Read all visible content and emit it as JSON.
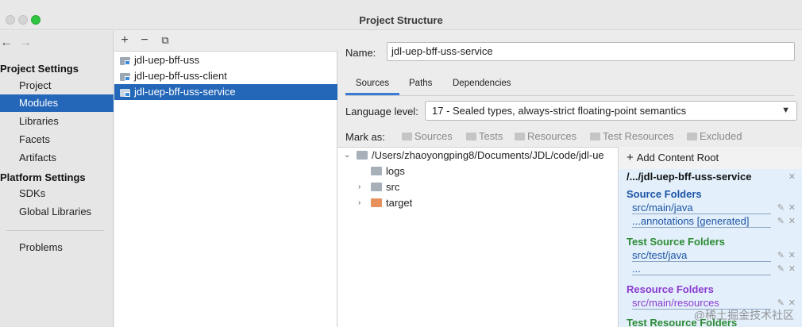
{
  "window": {
    "title": "Project Structure"
  },
  "sidebar": {
    "back_glyph": "←",
    "forward_glyph": "→",
    "project_settings_header": "Project Settings",
    "project_items": [
      {
        "label": "Project"
      },
      {
        "label": "Modules",
        "selected": true
      },
      {
        "label": "Libraries"
      },
      {
        "label": "Facets"
      },
      {
        "label": "Artifacts"
      }
    ],
    "platform_settings_header": "Platform Settings",
    "platform_items": [
      {
        "label": "SDKs"
      },
      {
        "label": "Global Libraries"
      }
    ],
    "problems": {
      "label": "Problems"
    }
  },
  "module_toolbar": {
    "add_glyph": "+",
    "remove_glyph": "−",
    "copy_glyph": "⧉"
  },
  "modules": [
    {
      "label": "jdl-uep-bff-uss"
    },
    {
      "label": "jdl-uep-bff-uss-client"
    },
    {
      "label": "jdl-uep-bff-uss-service",
      "selected": true
    }
  ],
  "details": {
    "name_label": "Name:",
    "name_value": "jdl-uep-bff-uss-service",
    "tabs": [
      {
        "label": "Sources",
        "active": true
      },
      {
        "label": "Paths"
      },
      {
        "label": "Dependencies"
      }
    ],
    "language_level_label": "Language level:",
    "language_level_value": "17 - Sealed types, always-strict floating-point semantics",
    "mark_as_label": "Mark as:",
    "mark_buttons": [
      {
        "label": "Sources"
      },
      {
        "label": "Tests"
      },
      {
        "label": "Resources"
      },
      {
        "label": "Test Resources"
      },
      {
        "label": "Excluded"
      }
    ]
  },
  "tree": {
    "root": "/Users/zhaoyongping8/Documents/JDL/code/jdl-ue",
    "children": [
      {
        "label": "logs",
        "expandable": false
      },
      {
        "label": "src",
        "expandable": true
      },
      {
        "label": "target",
        "expandable": true,
        "color": "#e7915c"
      }
    ]
  },
  "content_root": {
    "add_label": "Add Content Root",
    "path": "/.../jdl-uep-bff-uss-service",
    "source_folders_title": "Source Folders",
    "source_folders": [
      "src/main/java",
      "...annotations [generated]"
    ],
    "test_source_folders_title": "Test Source Folders",
    "test_source_folders": [
      "src/test/java",
      "..."
    ],
    "resource_folders_title": "Resource Folders",
    "resource_folders": [
      "src/main/resources"
    ],
    "test_resource_folders_title": "Test Resource Folders"
  },
  "watermark": "@稀土掘金技术社区",
  "colors": {
    "selection": "#2466b8",
    "source_blue": "#1c55a6",
    "test_green": "#2c8b34",
    "resource_purple": "#8a3bd1",
    "content_root_bg": "#e3effa"
  }
}
